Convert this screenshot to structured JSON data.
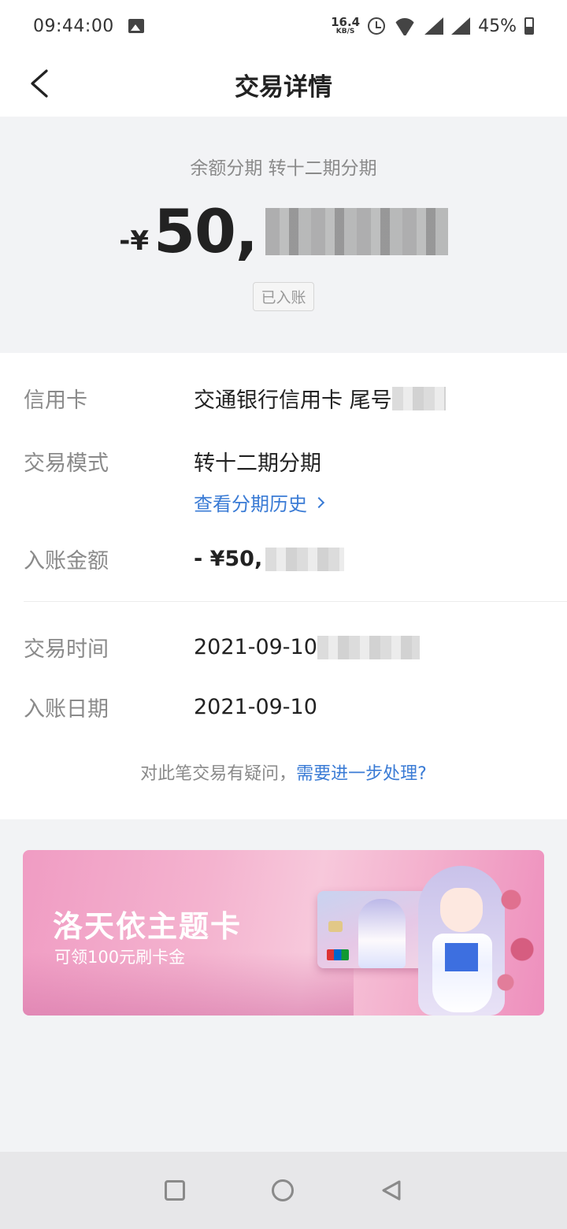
{
  "status_bar": {
    "time": "09:44:00",
    "net_speed_value": "16.4",
    "net_speed_unit": "KB/S",
    "battery_percent": "45%"
  },
  "header": {
    "title": "交易详情"
  },
  "summary": {
    "subtitle": "余额分期 转十二期分期",
    "amount_prefix": "-¥",
    "amount_visible": "50,",
    "status_tag": "已入账"
  },
  "details": {
    "card_label": "信用卡",
    "card_value": "交通银行信用卡 尾号",
    "mode_label": "交易模式",
    "mode_value": "转十二期分期",
    "history_link": "查看分期历史",
    "posted_amount_label": "入账金额",
    "posted_amount_value": "- ¥50,",
    "trade_time_label": "交易时间",
    "trade_time_value": "2021-09-10",
    "posted_date_label": "入账日期",
    "posted_date_value": "2021-09-10",
    "query_text": "对此笔交易有疑问，",
    "query_link": "需要进一步处理?"
  },
  "banner": {
    "title": "洛天依主题卡",
    "subtitle": "可领100元刷卡金"
  },
  "colors": {
    "link_blue": "#3a7bd5",
    "banner_pink": "#f4b3cf"
  }
}
